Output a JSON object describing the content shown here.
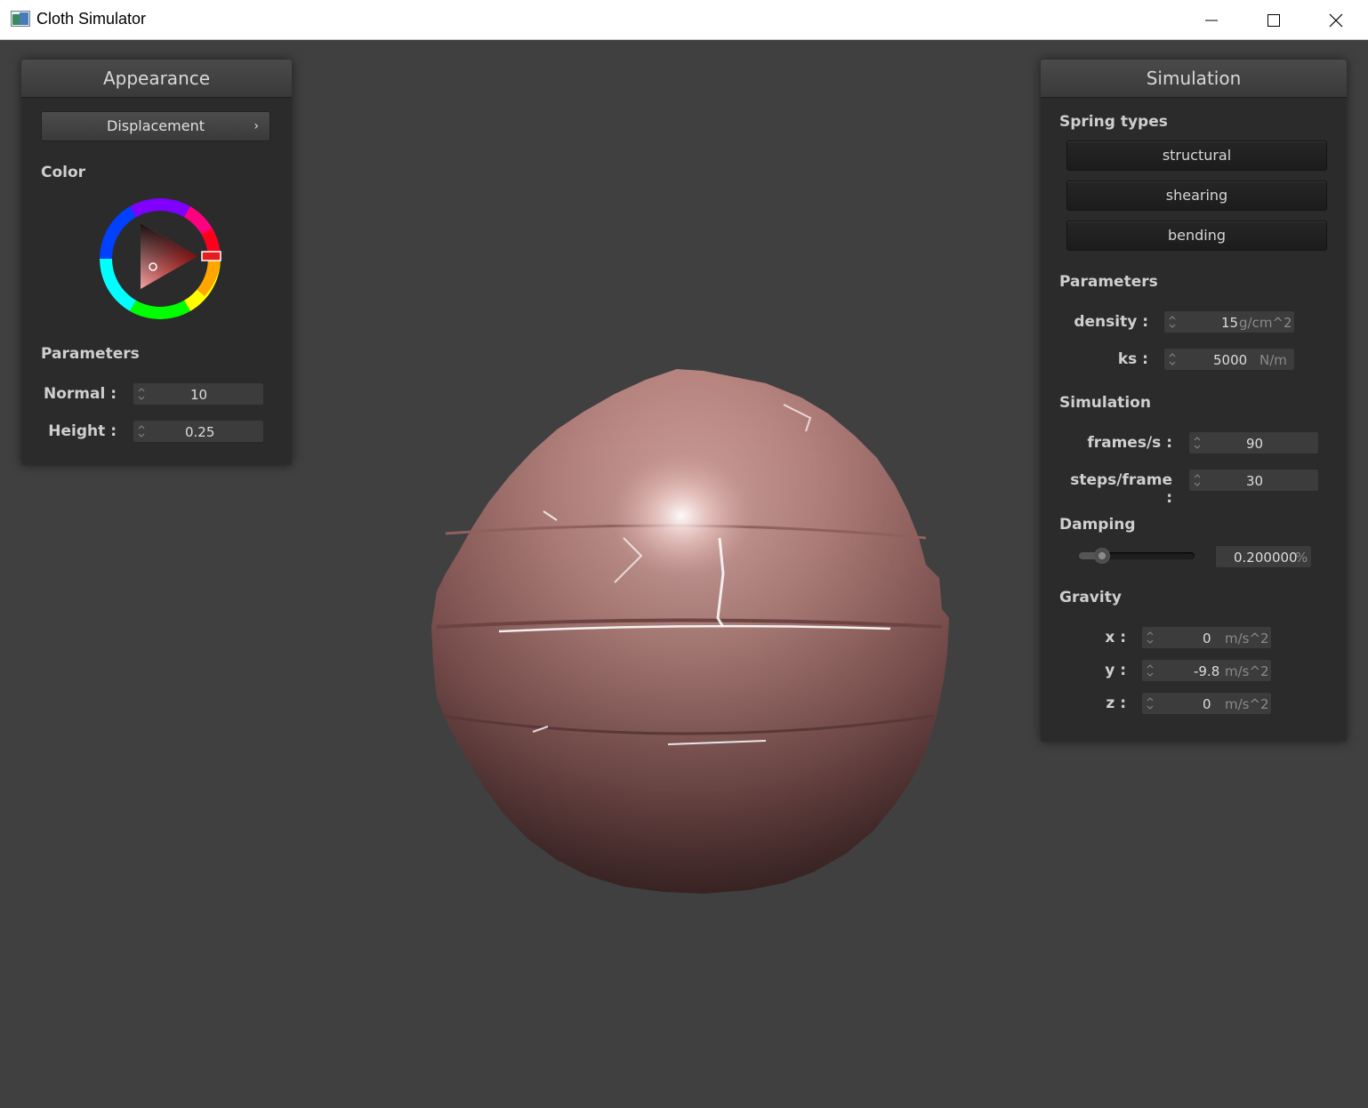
{
  "window": {
    "title": "Cloth Simulator"
  },
  "appearance": {
    "header": "Appearance",
    "shader_select": "Displacement",
    "color_label": "Color",
    "color_value": "#e41e1e",
    "parameters_label": "Parameters",
    "normal_label": "Normal :",
    "normal_value": "10",
    "height_label": "Height :",
    "height_value": "0.25"
  },
  "simulation": {
    "header": "Simulation",
    "spring_types_label": "Spring types",
    "spring_buttons": [
      "structural",
      "shearing",
      "bending"
    ],
    "parameters_label": "Parameters",
    "density_label": "density :",
    "density_value": "15",
    "density_unit": "g/cm^2",
    "ks_label": "ks :",
    "ks_value": "5000",
    "ks_unit": "N/m",
    "simulation_label": "Simulation",
    "fps_label": "frames/s :",
    "fps_value": "90",
    "steps_label": "steps/frame :",
    "steps_value": "30",
    "damping_label": "Damping",
    "damping_fraction": 0.2,
    "damping_value": "0.200000",
    "damping_unit": "%",
    "gravity_label": "Gravity",
    "gx_label": "x :",
    "gx_value": "0",
    "gy_label": "y :",
    "gy_value": "-9.8",
    "gz_label": "z :",
    "gz_value": "0",
    "gravity_unit": "m/s^2"
  },
  "scene": {
    "cloth_color": "#b07a7a",
    "background": "#404040"
  }
}
